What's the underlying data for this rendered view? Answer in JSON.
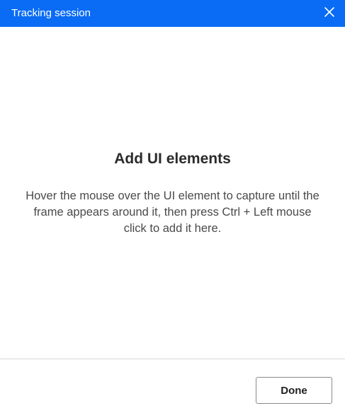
{
  "window": {
    "title": "Tracking session",
    "accent_color": "#0a6cf5",
    "close_icon": "close-icon"
  },
  "main": {
    "heading": "Add UI elements",
    "description": "Hover the mouse over the UI element to capture until the frame appears around it, then press Ctrl + Left mouse click to add it here."
  },
  "footer": {
    "done_label": "Done"
  }
}
